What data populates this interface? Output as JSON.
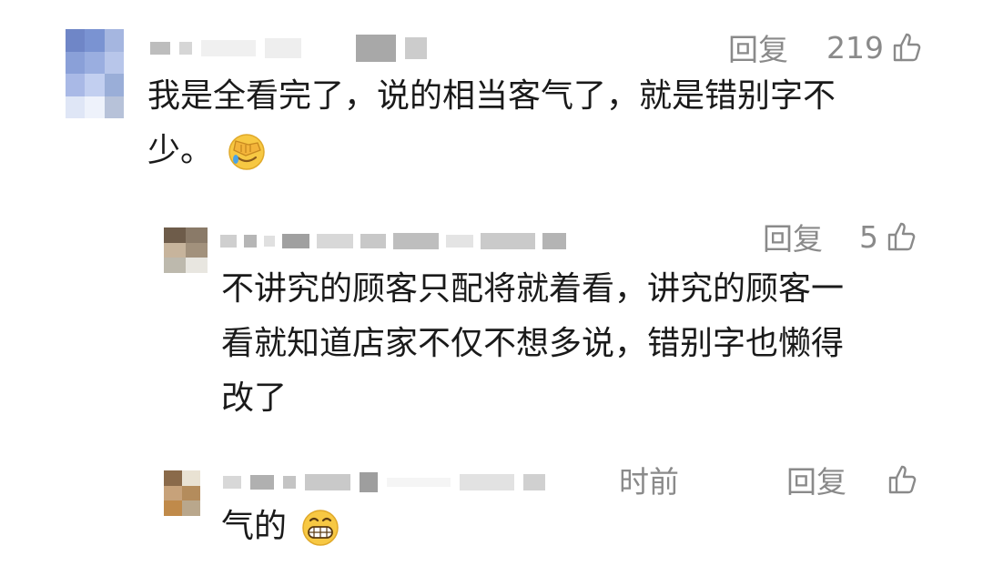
{
  "comments": [
    {
      "reply_label": "回复",
      "like_count": "219",
      "text_lines": [
        "我是全看完了，说的相当客气了，就是错别字不",
        "少。"
      ],
      "emoji": "face-palm-emoji"
    },
    {
      "reply_label": "回复",
      "like_count": "5",
      "text_lines": [
        "不讲究的顾客只配将就着看，讲究的顾客一",
        "看就知道店家不仅不想多说，错别字也懒得",
        "改了"
      ]
    },
    {
      "time_fragment": "时前",
      "reply_label": "回复",
      "like_count": "",
      "text_lines": [
        "气的"
      ],
      "emoji": "grinning-emoji"
    }
  ],
  "icons": {
    "like": "thumbs-up-icon"
  },
  "colors": {
    "meta_gray": "#8a8a8a",
    "text": "#1a1a1a",
    "background": "#ffffff"
  }
}
